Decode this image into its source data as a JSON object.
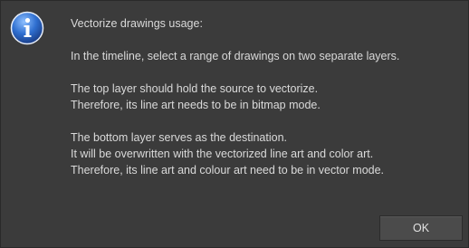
{
  "dialog": {
    "icon": "info-icon",
    "message": {
      "heading": "Vectorize drawings usage:",
      "paragraph1": "In the timeline, select a range of drawings on two separate layers.",
      "paragraph2_line1": "The top layer should hold the source to vectorize.",
      "paragraph2_line2": "Therefore, its line art needs to be in bitmap mode.",
      "paragraph3_line1": "The bottom layer serves as the destination.",
      "paragraph3_line2": "It will be overwritten with the vectorized line art and color art.",
      "paragraph3_line3": "Therefore, its line art and colour art need to be in vector mode."
    },
    "ok_label": "OK"
  },
  "colors": {
    "background": "#3b3b3b",
    "text": "#dadada",
    "icon_blue": "#2f6fd0"
  }
}
